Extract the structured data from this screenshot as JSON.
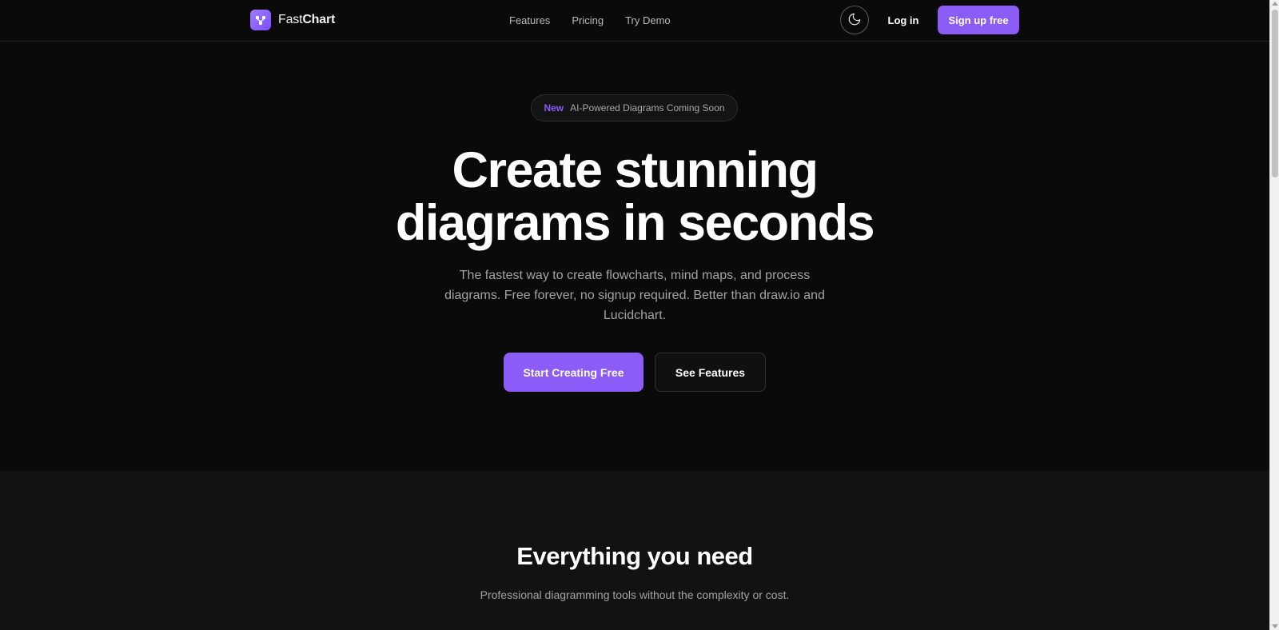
{
  "nav": {
    "brand_light": "Fast",
    "brand_bold": "Chart",
    "logo_icon": "diagram-nodes-icon",
    "links": [
      {
        "label": "Features"
      },
      {
        "label": "Pricing"
      },
      {
        "label": "Try Demo"
      }
    ],
    "theme_icon": "moon-icon",
    "login_label": "Log in",
    "signup_label": "Sign up free"
  },
  "hero": {
    "badge_tag": "New",
    "badge_text": "AI-Powered Diagrams Coming Soon",
    "title_line1": "Create stunning",
    "title_line2": "diagrams in seconds",
    "subtitle": "The fastest way to create flowcharts, mind maps, and process diagrams. Free forever, no signup required. Better than draw.io and Lucidchart.",
    "cta_primary": "Start Creating Free",
    "cta_secondary": "See Features"
  },
  "features": {
    "title": "Everything you need",
    "subtitle": "Professional diagramming tools without the complexity or cost."
  },
  "colors": {
    "accent": "#8b5cf6",
    "background": "#0a0a0a",
    "section_background": "#121212",
    "muted_text": "#a3a3a3"
  }
}
